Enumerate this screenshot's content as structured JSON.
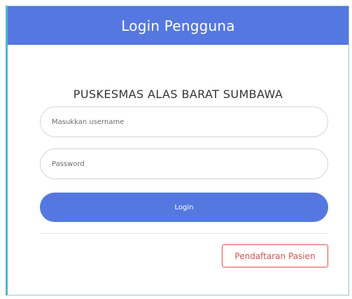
{
  "header": {
    "title": "Login Pengguna"
  },
  "org": {
    "name": "PUSKESMAS ALAS BARAT SUMBAWA"
  },
  "form": {
    "username": {
      "placeholder": "Masukkan username",
      "value": ""
    },
    "password": {
      "placeholder": "Password",
      "value": ""
    },
    "login_label": "Login"
  },
  "footer": {
    "register_label": "Pendaftaran Pasien"
  },
  "colors": {
    "header_bg": "#5578e0",
    "primary_button": "#5578e0",
    "register_accent": "#d9534f",
    "card_left_border": "#4fb5d6"
  }
}
